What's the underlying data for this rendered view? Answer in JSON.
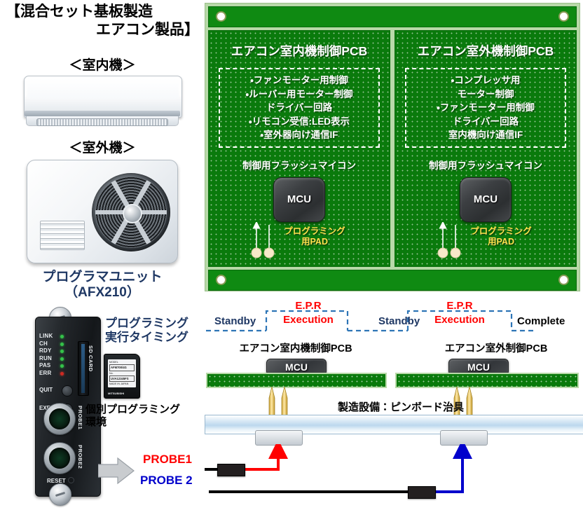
{
  "title": {
    "line1": "【混合セット基板製造",
    "line2": "エアコン製品】"
  },
  "left_column": {
    "indoor_label": "＜室内機＞",
    "outdoor_label": "＜室外機＞",
    "programmer_title_line1": "プログラマユニット",
    "programmer_title_line2": "（AFX210）",
    "programming_timing_label_line1": "プログラミング",
    "programming_timing_label_line2": "実行タイミング",
    "individual_env_line1": "個別プログラミング",
    "individual_env_line2": "環境"
  },
  "programmer_unit": {
    "leds": [
      {
        "name": "LINK",
        "color": "#35c24a"
      },
      {
        "name": "CH",
        "color": "#35c24a"
      },
      {
        "name": "RDY",
        "color": "#35c24a"
      },
      {
        "name": "RUN",
        "color": "#35c24a"
      },
      {
        "name": "PAS",
        "color": "#35c24a"
      },
      {
        "name": "ERR",
        "color": "#cf2a22"
      }
    ],
    "buttons": [
      "QUIT",
      "EXE1"
    ],
    "slot_label": "SD CARD",
    "port1_label": "PROBE1",
    "port2_label": "PROBE2",
    "reset_label": "RESET",
    "sd_card": {
      "model_caption": "MODEL",
      "model": "AFM700/4G",
      "no_caption": "No.",
      "serial": "UVA12345FS",
      "note": "MADE IN JAPAN",
      "brand": "MITSUBISHI"
    }
  },
  "pcb_panel": {
    "boards": [
      {
        "title": "エアコン室内機制御PCB",
        "specs": [
          "・ファンモーター用制御",
          "・ルーバー用モーター制御",
          "ドライバー回路",
          "・リモコン受信:LED表示",
          "・室外器向け通信IF"
        ],
        "mcu_caption": "制御用フラッシュマイコン",
        "mcu_label": "MCU",
        "pad_label_line1": "プログラミング",
        "pad_label_line2": "用PAD"
      },
      {
        "title": "エアコン室外機制御PCB",
        "specs": [
          "・コンプレッサ用",
          "モーター制御",
          "・ファンモーター用制御",
          "ドライバー回路",
          "室内機向け通信IF"
        ],
        "mcu_caption": "制御用フラッシュマイコン",
        "mcu_label": "MCU",
        "pad_label_line1": "プログラミング",
        "pad_label_line2": "用PAD"
      }
    ]
  },
  "timing": {
    "standby1": "Standby",
    "epr1_top": "E.P.R",
    "epr1_bottom": "Execution",
    "standby2": "Standby",
    "epr2_top": "E.P.R",
    "epr2_bottom": "Execution",
    "complete": "Complete"
  },
  "lower_diagram": {
    "left_pcb_label": "エアコン室内機制御PCB",
    "right_pcb_label": "エアコン室外制御PCB",
    "mcu_label_left": "MCU",
    "mcu_label_right": "MCU",
    "equipment_label": "製造設備：ピンボード治具",
    "probe1_label": "PROBE1",
    "probe2_label": "PROBE 2"
  },
  "colors": {
    "pcb_green": "#0a7a0c",
    "panel_edge": "#b8d9a8",
    "rail_green": "#0f8a12",
    "navy": "#1f3864",
    "red": "#ff0000",
    "blue": "#0000cc",
    "pad_yellow": "#ffe14d",
    "pin_gold": "#e8b93a"
  }
}
